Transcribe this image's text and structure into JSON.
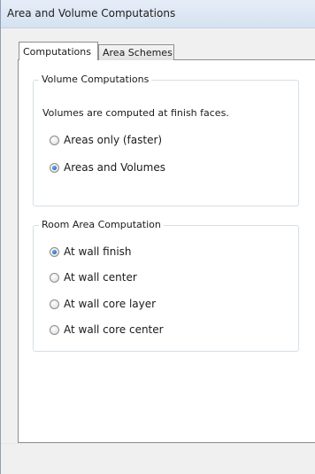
{
  "window": {
    "title": "Area and Volume Computations"
  },
  "tabs": [
    {
      "label": "Computations",
      "active": true
    },
    {
      "label": "Area Schemes",
      "active": false
    }
  ],
  "volume_group": {
    "legend": "Volume Computations",
    "description": "Volumes are computed at finish faces.",
    "options": [
      {
        "label": "Areas only (faster)",
        "checked": false
      },
      {
        "label": "Areas and Volumes",
        "checked": true
      }
    ]
  },
  "room_group": {
    "legend": "Room Area Computation",
    "options": [
      {
        "label": "At wall finish",
        "checked": true
      },
      {
        "label": "At wall center",
        "checked": false
      },
      {
        "label": "At wall core layer",
        "checked": false
      },
      {
        "label": "At wall core center",
        "checked": false
      }
    ]
  },
  "colors": {
    "titlebar": "#dce6f4",
    "panel_bg": "#ffffff",
    "window_bg": "#f0f0f0",
    "radio_selected": "#1d5fbd"
  }
}
